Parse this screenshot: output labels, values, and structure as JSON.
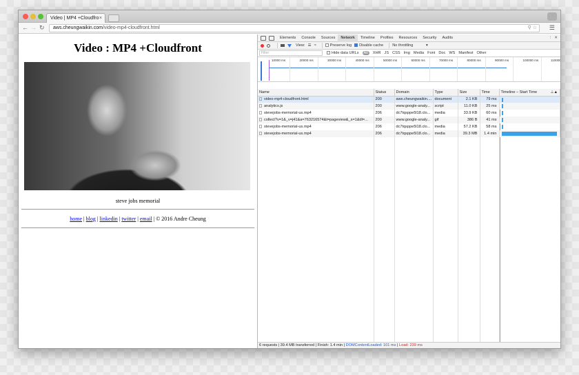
{
  "browser": {
    "tab_title": "Video | MP4 +Cloudfro",
    "tab_close": "×",
    "url_host": "aws.cheungwaikin.com",
    "url_path": "/video-mp4-cloudfront.html"
  },
  "page": {
    "heading": "Video : MP4 +Cloudfront",
    "caption": "steve jobs memorial",
    "links": [
      "home",
      "blog",
      "linkedin",
      "twitter",
      "email"
    ],
    "separator": "|",
    "copyright": "| © 2016 Andre Cheung"
  },
  "devtools": {
    "tabs": [
      "Elements",
      "Console",
      "Sources",
      "Network",
      "Timeline",
      "Profiles",
      "Resources",
      "Security",
      "Audits"
    ],
    "active_tab": "Network",
    "toolbar": {
      "view_label": "View:",
      "preserve_log": "Preserve log",
      "disable_cache": "Disable cache",
      "throttling": "No throttling"
    },
    "filter_placeholder": "Filter",
    "hide_data_urls": "Hide data URLs",
    "filter_types": [
      "All",
      "XHR",
      "JS",
      "CSS",
      "Img",
      "Media",
      "Font",
      "Doc",
      "WS",
      "Manifest",
      "Other"
    ],
    "overview_ticks": [
      "10000 ms",
      "20000 ms",
      "30000 ms",
      "40000 ms",
      "50000 ms",
      "60000 ms",
      "70000 ms",
      "80000 ms",
      "90000 ms",
      "100000 ms",
      "110000"
    ],
    "columns": [
      "Name",
      "Status",
      "Domain",
      "Type",
      "Size",
      "Time",
      "Timeline – Start Time"
    ],
    "rows": [
      {
        "name": "video-mp4-cloudfront.html",
        "status": "200",
        "domain": "aws.cheungwaikin....",
        "type": "document",
        "size": "2.1 KB",
        "time": "79 ms",
        "start_frac": 0.0,
        "dur_frac": 0.01
      },
      {
        "name": "analytics.js",
        "status": "200",
        "domain": "www.google-analy...",
        "type": "script",
        "size": "11.0 KB",
        "time": "25 ms",
        "start_frac": 0.005,
        "dur_frac": 0.008
      },
      {
        "name": "stevejobs-memorial-us.mp4",
        "status": "206",
        "domain": "dc7tqsppe5l18.clo...",
        "type": "media",
        "size": "33.9 KB",
        "time": "60 ms",
        "start_frac": 0.006,
        "dur_frac": 0.01
      },
      {
        "name": "collect?v=1&_v=j41&a=763216574&t=pageview&_s=1&dl=...",
        "status": "200",
        "domain": "www.google-analy...",
        "type": "gif",
        "size": "386 B",
        "time": "41 ms",
        "start_frac": 0.007,
        "dur_frac": 0.008
      },
      {
        "name": "stevejobs-memorial-us.mp4",
        "status": "206",
        "domain": "dc7tqsppe5l18.clo...",
        "type": "media",
        "size": "57.2 KB",
        "time": "58 ms",
        "start_frac": 0.008,
        "dur_frac": 0.01
      },
      {
        "name": "stevejobs-memorial-us.mp4",
        "status": "206",
        "domain": "dc7tqsppe5l18.clo...",
        "type": "media",
        "size": "39.3 MB",
        "time": "1.4 min",
        "start_frac": 0.01,
        "dur_frac": 0.99
      }
    ],
    "status_bar": {
      "summary": "6 requests | 39.4 MB transferred | Finish: 1.4 min |",
      "dcl": "DOMContentLoaded: 101 ms",
      "load": "Load: 239 ms"
    }
  }
}
